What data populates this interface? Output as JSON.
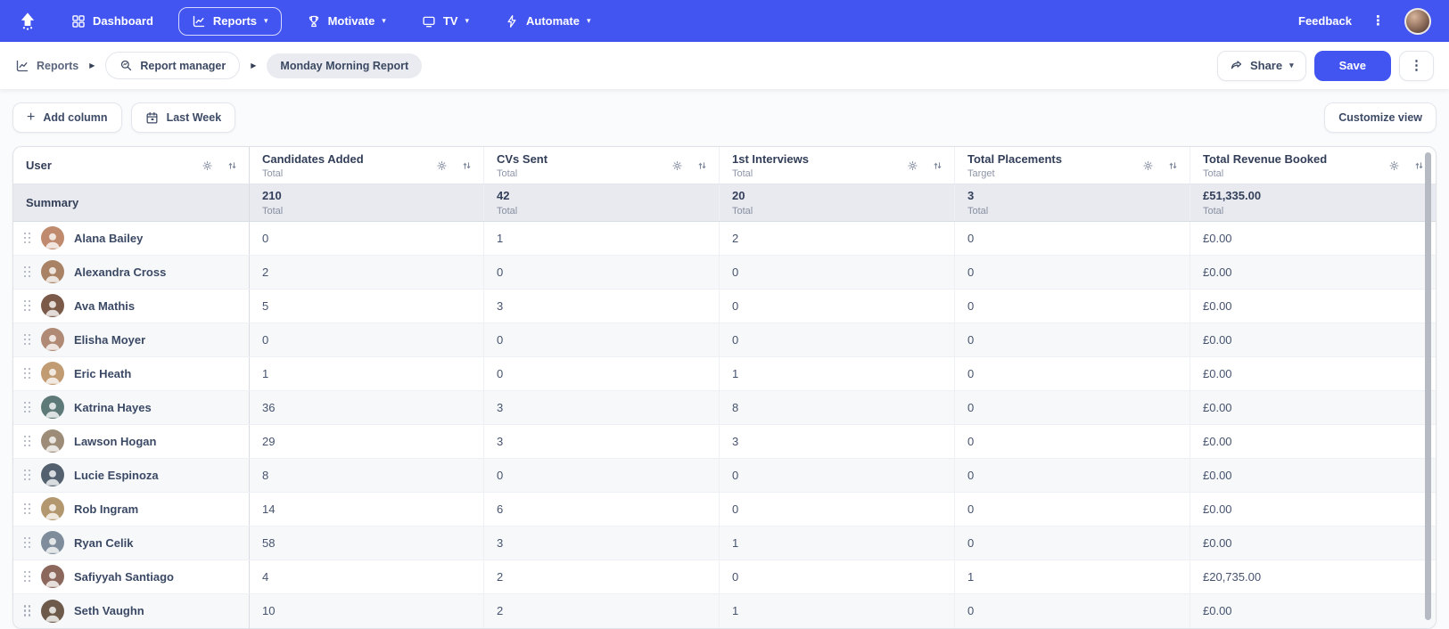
{
  "nav": {
    "items": [
      {
        "label": "Dashboard",
        "icon": "dashboard-grid-icon",
        "active": false,
        "caret": false
      },
      {
        "label": "Reports",
        "icon": "reports-chart-icon",
        "active": true,
        "caret": true
      },
      {
        "label": "Motivate",
        "icon": "trophy-icon",
        "active": false,
        "caret": true
      },
      {
        "label": "TV",
        "icon": "tv-icon",
        "active": false,
        "caret": true
      },
      {
        "label": "Automate",
        "icon": "bolt-icon",
        "active": false,
        "caret": true
      }
    ],
    "feedback_label": "Feedback"
  },
  "breadcrumb": {
    "root": "Reports",
    "manager": "Report manager",
    "report": "Monday Morning Report"
  },
  "actions": {
    "share": "Share",
    "save": "Save"
  },
  "toolbar": {
    "add_column": "Add column",
    "date_filter": "Last Week",
    "customize": "Customize view"
  },
  "table": {
    "columns": [
      {
        "title": "User",
        "subtitle": ""
      },
      {
        "title": "Candidates Added",
        "subtitle": "Total"
      },
      {
        "title": "CVs Sent",
        "subtitle": "Total"
      },
      {
        "title": "1st Interviews",
        "subtitle": "Total"
      },
      {
        "title": "Total Placements",
        "subtitle": "Target"
      },
      {
        "title": "Total Revenue Booked",
        "subtitle": "Total"
      }
    ],
    "summary": {
      "label": "Summary",
      "sublabel": "Total",
      "values": [
        "210",
        "42",
        "20",
        "3",
        "£51,335.00"
      ]
    },
    "rows": [
      {
        "name": "Alana Bailey",
        "avatar_color": "#c08a6e",
        "values": [
          "0",
          "1",
          "2",
          "0",
          "£0.00"
        ]
      },
      {
        "name": "Alexandra Cross",
        "avatar_color": "#a98265",
        "values": [
          "2",
          "0",
          "0",
          "0",
          "£0.00"
        ]
      },
      {
        "name": "Ava Mathis",
        "avatar_color": "#7b5a49",
        "values": [
          "5",
          "3",
          "0",
          "0",
          "£0.00"
        ]
      },
      {
        "name": "Elisha Moyer",
        "avatar_color": "#b08a74",
        "values": [
          "0",
          "0",
          "0",
          "0",
          "£0.00"
        ]
      },
      {
        "name": "Eric Heath",
        "avatar_color": "#c19b72",
        "values": [
          "1",
          "0",
          "1",
          "0",
          "£0.00"
        ]
      },
      {
        "name": "Katrina Hayes",
        "avatar_color": "#5e7a78",
        "values": [
          "36",
          "3",
          "8",
          "0",
          "£0.00"
        ]
      },
      {
        "name": "Lawson Hogan",
        "avatar_color": "#9d8c77",
        "values": [
          "29",
          "3",
          "3",
          "0",
          "£0.00"
        ]
      },
      {
        "name": "Lucie Espinoza",
        "avatar_color": "#53606e",
        "values": [
          "8",
          "0",
          "0",
          "0",
          "£0.00"
        ]
      },
      {
        "name": "Rob Ingram",
        "avatar_color": "#b3986f",
        "values": [
          "14",
          "6",
          "0",
          "0",
          "£0.00"
        ]
      },
      {
        "name": "Ryan Celik",
        "avatar_color": "#7e8c9b",
        "values": [
          "58",
          "3",
          "1",
          "0",
          "£0.00"
        ]
      },
      {
        "name": "Safiyyah Santiago",
        "avatar_color": "#8c685c",
        "values": [
          "4",
          "2",
          "0",
          "1",
          "£20,735.00"
        ]
      },
      {
        "name": "Seth Vaughn",
        "avatar_color": "#6d5a4b",
        "values": [
          "10",
          "2",
          "1",
          "0",
          "£0.00"
        ]
      }
    ]
  },
  "colors": {
    "accent": "#4355f1",
    "summary_bg": "#e8eaef",
    "stripe_bg": "#f6f8fa"
  }
}
